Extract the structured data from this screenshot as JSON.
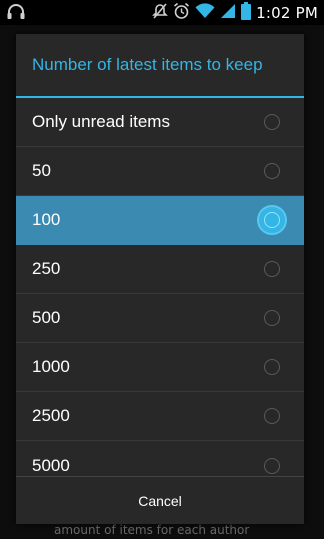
{
  "status_bar": {
    "time": "1:02 PM",
    "icons": [
      "headset-icon",
      "mute-icon",
      "alarm-icon",
      "wifi-icon",
      "signal-icon",
      "battery-icon"
    ]
  },
  "background_text": "amount of items for each author",
  "dialog": {
    "title": "Number of latest items to keep",
    "accent_color": "#33b5e5",
    "selected_color": "#3a8ab1",
    "options": [
      {
        "label": "Only unread items",
        "selected": false
      },
      {
        "label": "50",
        "selected": false
      },
      {
        "label": "100",
        "selected": true
      },
      {
        "label": "250",
        "selected": false
      },
      {
        "label": "500",
        "selected": false
      },
      {
        "label": "1000",
        "selected": false
      },
      {
        "label": "2500",
        "selected": false
      },
      {
        "label": "5000",
        "selected": false
      }
    ],
    "cancel_label": "Cancel"
  }
}
